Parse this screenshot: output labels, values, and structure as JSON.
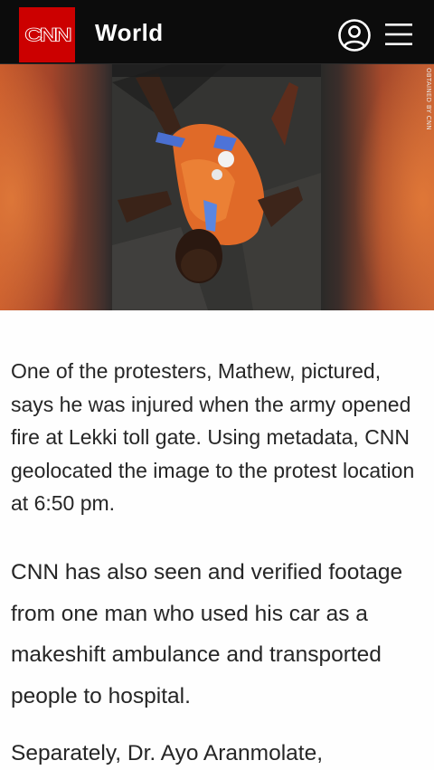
{
  "header": {
    "logo_text": "CNN",
    "section_title": "World",
    "brand_color": "#cc0000",
    "background_color": "#0c0c0c",
    "account_icon": "account-circle-icon",
    "menu_icon": "hamburger-menu-icon"
  },
  "hero": {
    "credit": "OBTAINED BY CNN"
  },
  "article": {
    "paragraphs": [
      "One of the protesters, Mathew, pictured, says he was injured when the army opened fire at Lekki toll gate. Using metadata, CNN geolocated the image to the protest location at 6:50 pm.",
      "CNN has also seen and verified footage from one man who used his car as a makeshift ambulance and transported people to hospital.",
      "Separately, Dr. Ayo Aranmolate,"
    ]
  }
}
